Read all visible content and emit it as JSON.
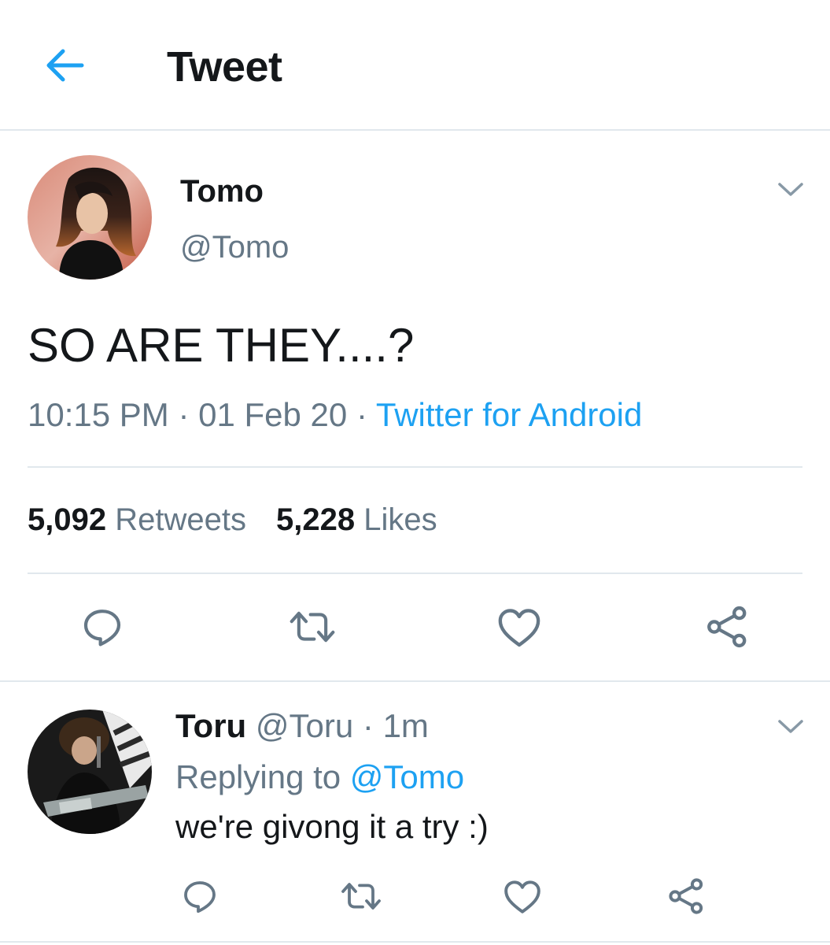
{
  "header": {
    "title": "Tweet",
    "back_icon": "arrow-left-icon",
    "accent_color": "#1da1f2"
  },
  "tweet": {
    "author_name": "Tomo",
    "author_handle": "@Tomo",
    "text": "SO ARE THEY....?",
    "time": "10:15 PM",
    "date": "01 Feb 20",
    "separator": "·",
    "source": "Twitter for Android",
    "retweets_count": "5,092",
    "retweets_label": "Retweets",
    "likes_count": "5,228",
    "likes_label": "Likes",
    "actions": [
      "reply-icon",
      "retweet-icon",
      "like-icon",
      "share-icon"
    ]
  },
  "reply": {
    "author_name": "Toru",
    "author_handle": "@Toru",
    "separator": "·",
    "time": "1m",
    "replying_label": "Replying to",
    "replying_to": "@Tomo",
    "text": "we're givong it a try :)",
    "actions": [
      "reply-icon",
      "retweet-icon",
      "like-icon",
      "share-icon"
    ]
  },
  "colors": {
    "text": "#14171a",
    "muted": "#657786",
    "link": "#1da1f2",
    "divider": "#e1e8ed"
  }
}
